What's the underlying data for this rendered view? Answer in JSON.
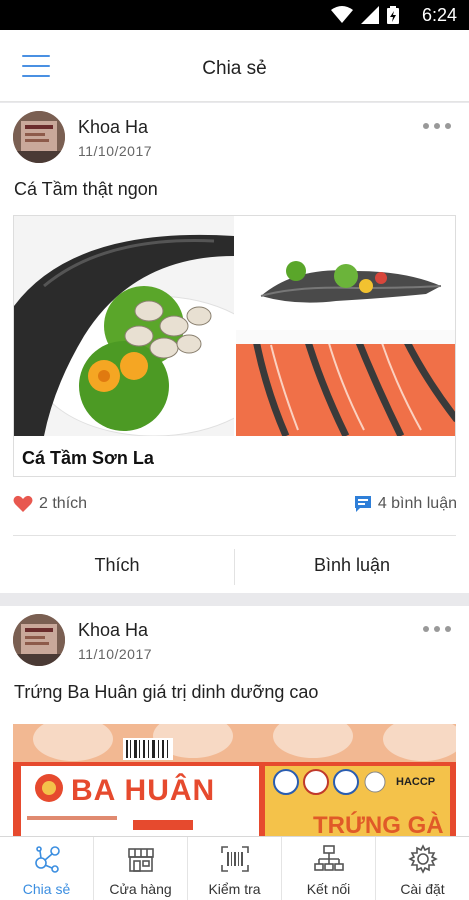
{
  "status_bar": {
    "time": "6:24"
  },
  "app_bar": {
    "title": "Chia sẻ"
  },
  "posts": [
    {
      "author": "Khoa Ha",
      "date": "11/10/2017",
      "text": "Cá Tầm thật ngon",
      "gallery_caption": "Cá Tầm Sơn La",
      "likes": "2 thích",
      "comments": "4 bình luận",
      "like_label": "Thích",
      "comment_label": "Bình luận"
    },
    {
      "author": "Khoa Ha",
      "date": "11/10/2017",
      "text": "Trứng Ba Huân giá trị dinh dưỡng cao",
      "brand_text": "BA HUÂN",
      "product_text": "TRỨNG GÀ",
      "cert_text": "HACCP"
    }
  ],
  "tabs": [
    {
      "label": "Chia sẻ",
      "icon": "share-network-icon",
      "active": true
    },
    {
      "label": "Cửa hàng",
      "icon": "store-icon",
      "active": false
    },
    {
      "label": "Kiểm tra",
      "icon": "barcode-scan-icon",
      "active": false
    },
    {
      "label": "Kết nối",
      "icon": "network-connect-icon",
      "active": false
    },
    {
      "label": "Cài đặt",
      "icon": "gear-icon",
      "active": false
    }
  ],
  "colors": {
    "accent": "#3b8ee0",
    "heart": "#e8584f",
    "comment": "#2f7fd8"
  }
}
